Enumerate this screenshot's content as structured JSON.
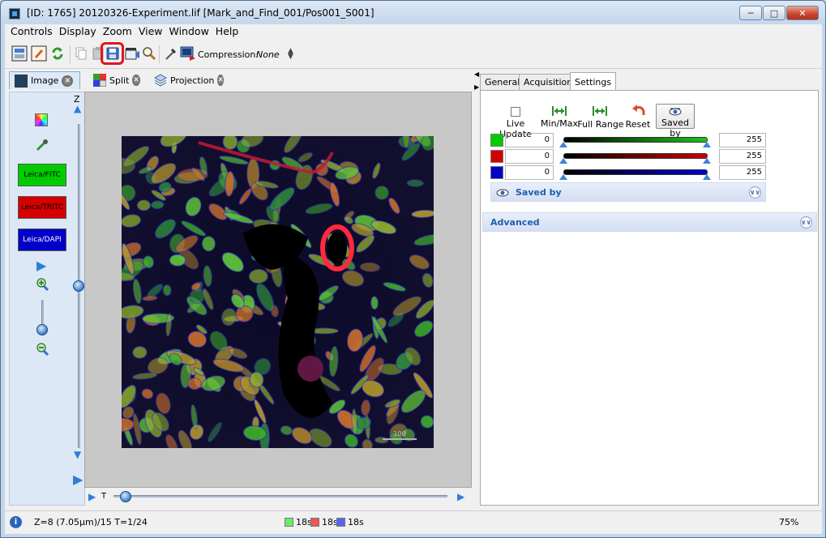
{
  "window": {
    "title": "[ID: 1765] 20120326-Experiment.lif [Mark_and_Find_001/Pos001_S001]"
  },
  "menubar": {
    "items": [
      "Controls",
      "Display",
      "Zoom",
      "View",
      "Window",
      "Help"
    ]
  },
  "toolbar": {
    "compression_label": "Compression:",
    "compression_value": "None"
  },
  "left_tabs": [
    {
      "label": "Image",
      "icon": "image-icon",
      "active": true
    },
    {
      "label": "Split",
      "icon": "split-grid-icon",
      "active": false
    },
    {
      "label": "Projection",
      "icon": "layers-icon",
      "active": false
    }
  ],
  "side": {
    "z_label": "Z",
    "channels": [
      {
        "label": "Leica/FITC",
        "color": "#00cc00"
      },
      {
        "label": "Leica/TRITC",
        "color": "#d40000"
      },
      {
        "label": "Leica/DAPI",
        "color": "#0000c8"
      }
    ],
    "z_level": 0.5
  },
  "image": {
    "scalebar_label": "100"
  },
  "t_slider": {
    "label": "T",
    "level": 0.0
  },
  "right_tabs": [
    {
      "label": "General",
      "active": false
    },
    {
      "label": "Acquisition",
      "active": false
    },
    {
      "label": "Settings",
      "active": true
    }
  ],
  "settings": {
    "tools": [
      {
        "label": "Live Update",
        "icon": "checkbox-icon"
      },
      {
        "label": "Min/Max",
        "icon": "min-max-arrows-icon"
      },
      {
        "label": "Full Range",
        "icon": "full-range-arrows-icon"
      },
      {
        "label": "Reset",
        "icon": "reset-arrow-icon"
      },
      {
        "label": "Saved by",
        "icon": "eye-icon"
      }
    ],
    "channel_rows": [
      {
        "color": "#00cc00",
        "min": "0",
        "max": "255",
        "bar": "#18c818"
      },
      {
        "color": "#d40000",
        "min": "0",
        "max": "255",
        "bar": "#d00000"
      },
      {
        "color": "#0000c8",
        "min": "0",
        "max": "255",
        "bar": "#0000d0"
      }
    ],
    "saved_by_section": "Saved by",
    "advanced_section": "Advanced"
  },
  "status": {
    "position": "Z=8 (7.05µm)/15 T=1/24",
    "channel_times": [
      {
        "label": "18s",
        "color": "#66ee66"
      },
      {
        "label": "18s",
        "color": "#ee5555"
      },
      {
        "label": "18s",
        "color": "#5566ee"
      }
    ],
    "zoom": "75%"
  }
}
